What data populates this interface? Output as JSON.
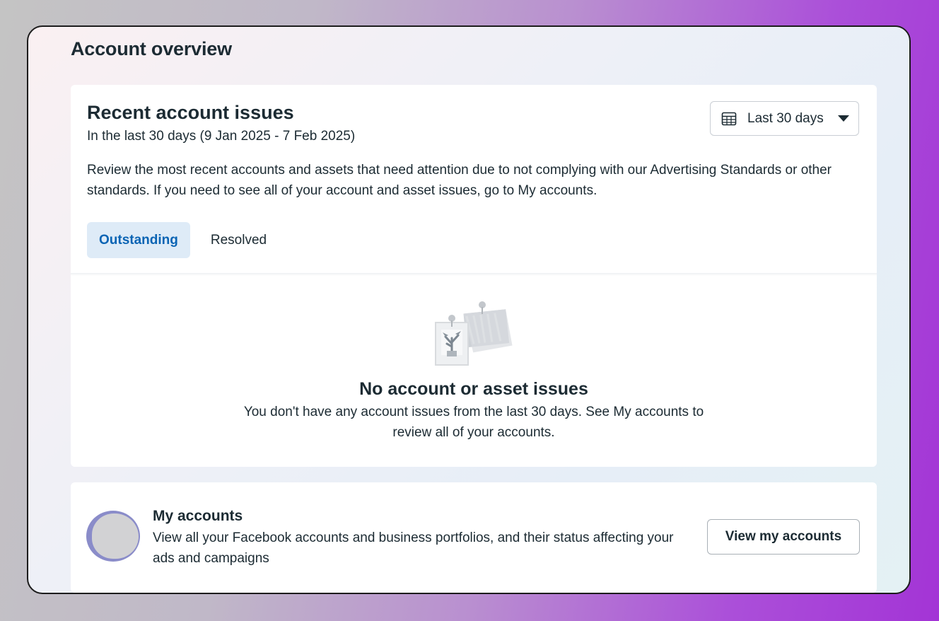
{
  "page": {
    "title": "Account overview"
  },
  "issues": {
    "title": "Recent account issues",
    "subtitle": "In the last 30 days (9 Jan 2025 - 7 Feb 2025)",
    "description": "Review the most recent accounts and assets that need attention due to not complying with our Advertising Standards or other standards. If you need to see all of your account and asset issues, go to My accounts.",
    "range": {
      "label": "Last 30 days",
      "icon": "calendar-icon"
    },
    "tabs": [
      {
        "label": "Outstanding",
        "active": true
      },
      {
        "label": "Resolved",
        "active": false
      }
    ],
    "empty": {
      "illustration": "notes-illustration",
      "title": "No account or asset issues",
      "description": "You don't have any account issues from the last 30 days. See My accounts to review all of your accounts."
    }
  },
  "accounts": {
    "title": "My accounts",
    "description": "View all your Facebook accounts and business portfolios, and their status affecting your ads and campaigns",
    "button_label": "View my accounts"
  },
  "colors": {
    "accent": "#0a64b4",
    "active_tab_bg": "#deebf7",
    "text": "#1c2b33"
  }
}
